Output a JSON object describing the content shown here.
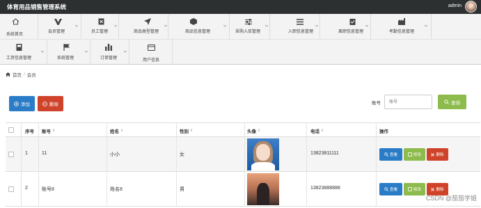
{
  "app": {
    "title": "体育用品销售管理系统",
    "username": "admin"
  },
  "nav": {
    "items": [
      {
        "label": "系统首页",
        "icon": "home-icon"
      },
      {
        "label": "会员管理",
        "icon": "vip-icon"
      },
      {
        "label": "员工管理",
        "icon": "staff-icon"
      },
      {
        "label": "商品类型管理",
        "icon": "send-icon"
      },
      {
        "label": "商品信息管理",
        "icon": "cube-icon"
      },
      {
        "label": "采购入库管理",
        "icon": "sliders-icon"
      },
      {
        "label": "入职信息管理",
        "icon": "list-icon"
      },
      {
        "label": "离职信息管理",
        "icon": "clipboard-icon"
      },
      {
        "label": "考勤信息管理",
        "icon": "factory-icon"
      },
      {
        "label": "工资信息管理",
        "icon": "book-icon"
      },
      {
        "label": "系统管理",
        "icon": "flag-icon"
      },
      {
        "label": "订单管理",
        "icon": "bar-chart-icon"
      },
      {
        "label": "用户信息",
        "icon": "id-card-icon"
      }
    ]
  },
  "breadcrumb": {
    "home": "首页",
    "separator": "/",
    "current": "会员"
  },
  "toolbar": {
    "add_label": "添加",
    "delete_label": "删除"
  },
  "search": {
    "label": "账号",
    "placeholder": "账号",
    "button": "查询"
  },
  "table": {
    "headers": {
      "index": "序号",
      "account": "账号",
      "name": "姓名",
      "gender": "性别",
      "avatar": "头像",
      "phone": "电话",
      "actions": "操作"
    },
    "rows": [
      {
        "index": "1",
        "account": "11",
        "name": "小小",
        "gender": "女",
        "phone": "13823811111"
      },
      {
        "index": "2",
        "account": "账号8",
        "name": "姓名8",
        "gender": "男",
        "phone": "13823888888"
      }
    ],
    "actions": {
      "view": "查看",
      "edit": "修改",
      "delete": "删除"
    }
  },
  "watermark": "CSDN @茄茄学姐",
  "colors": {
    "topbar": "#2d3031",
    "primary": "#2a7cc7",
    "danger": "#d0432b",
    "success": "#8dbb4c"
  }
}
